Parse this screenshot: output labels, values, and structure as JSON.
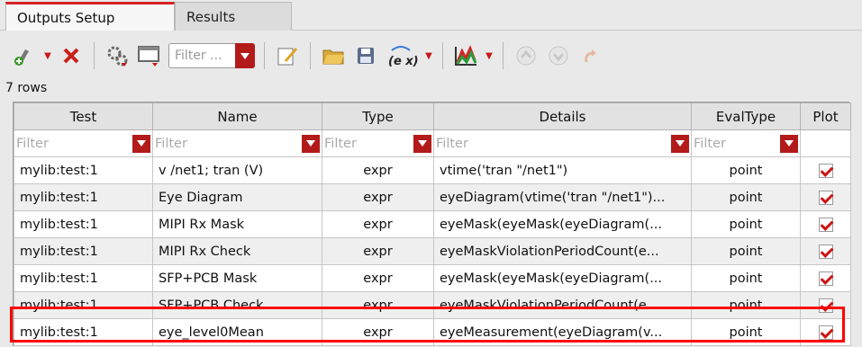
{
  "tabs": [
    {
      "label": "Outputs Setup",
      "active": true
    },
    {
      "label": "Results",
      "active": false
    }
  ],
  "toolbar": {
    "filter_placeholder": "Filter ...",
    "icons": [
      "add-output-icon",
      "delete-icon",
      "settings-icon",
      "columns-icon",
      "filter-dropdown",
      "edit-icon",
      "open-folder-icon",
      "save-icon",
      "expression-icon",
      "plot-icon",
      "up-icon",
      "down-icon",
      "redo-icon"
    ],
    "expression_label": "(e x)"
  },
  "row_count": "7 rows",
  "table": {
    "columns": [
      "Test",
      "Name",
      "Type",
      "Details",
      "EvalType",
      "Plot"
    ],
    "filter_placeholder": "Filter",
    "rows": [
      {
        "test": "mylib:test:1",
        "name": "v /net1; tran (V)",
        "type": "expr",
        "details": "vtime('tran \"/net1\")",
        "evaltype": "point",
        "plot": true
      },
      {
        "test": "mylib:test:1",
        "name": "Eye Diagram",
        "type": "expr",
        "details": "eyeDiagram(vtime('tran \"/net1\")...",
        "evaltype": "point",
        "plot": true
      },
      {
        "test": "mylib:test:1",
        "name": "MIPI Rx Mask",
        "type": "expr",
        "details": "eyeMask(eyeMask(eyeDiagram(...",
        "evaltype": "point",
        "plot": true
      },
      {
        "test": "mylib:test:1",
        "name": "MIPI Rx Check",
        "type": "expr",
        "details": "eyeMaskViolationPeriodCount(e...",
        "evaltype": "point",
        "plot": true
      },
      {
        "test": "mylib:test:1",
        "name": "SFP+PCB Mask",
        "type": "expr",
        "details": "eyeMask(eyeMask(eyeDiagram(...",
        "evaltype": "point",
        "plot": true
      },
      {
        "test": "mylib:test:1",
        "name": "SFP+PCB Check",
        "type": "expr",
        "details": "eyeMaskViolationPeriodCount(e...",
        "evaltype": "point",
        "plot": true
      },
      {
        "test": "mylib:test:1",
        "name": "eye_level0Mean",
        "type": "expr",
        "details": "eyeMeasurement(eyeDiagram(v...",
        "evaltype": "point",
        "plot": true
      }
    ]
  },
  "colors": {
    "accent": "#b31b1b",
    "highlight": "#ff0000"
  }
}
